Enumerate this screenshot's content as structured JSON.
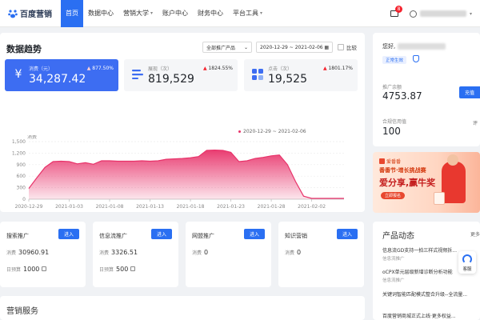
{
  "brand": {
    "name": "百度营销"
  },
  "nav": {
    "items": [
      {
        "label": "首页",
        "active": true,
        "caret": false
      },
      {
        "label": "数据中心",
        "active": false,
        "caret": false
      },
      {
        "label": "营销大学",
        "active": false,
        "caret": true
      },
      {
        "label": "账户中心",
        "active": false,
        "caret": false
      },
      {
        "label": "财务中心",
        "active": false,
        "caret": false
      },
      {
        "label": "平台工具",
        "active": false,
        "caret": true
      }
    ],
    "mail_badge": "8"
  },
  "trend": {
    "title": "数据趋势",
    "product_select": "全部推广产品",
    "date_range": "2020-12-29 ~ 2021-02-06",
    "compare_label": "比较",
    "metrics": [
      {
        "label": "消费（元）",
        "value": "34,287.42",
        "change": "877.50%"
      },
      {
        "label": "展现（次）",
        "value": "819,529",
        "change": "1824.55%"
      },
      {
        "label": "点击（次）",
        "value": "19,525",
        "change": "1801.17%"
      }
    ],
    "legend": "2020-12-29 ~ 2021-02-06"
  },
  "chart_data": {
    "type": "area",
    "ylabel": "消费",
    "ylim": [
      0,
      1500
    ],
    "yticks": [
      "1,500",
      "1,200",
      "900",
      "600",
      "300",
      "0"
    ],
    "xticks": [
      "2020-12-29",
      "2021-01-03",
      "2021-01-08",
      "2021-01-13",
      "2021-01-18",
      "2021-01-23",
      "2021-01-28",
      "2021-02-02"
    ],
    "series": [
      {
        "name": "",
        "x": [
          "2020-12-29",
          "2020-12-30",
          "2020-12-31",
          "2021-01-01",
          "2021-01-02",
          "2021-01-03",
          "2021-01-04",
          "2021-01-05",
          "2021-01-06",
          "2021-01-07",
          "2021-01-08",
          "2021-01-09",
          "2021-01-10",
          "2021-01-11",
          "2021-01-12",
          "2021-01-13",
          "2021-01-14",
          "2021-01-15",
          "2021-01-16",
          "2021-01-17",
          "2021-01-18",
          "2021-01-19",
          "2021-01-20",
          "2021-01-21",
          "2021-01-22",
          "2021-01-23",
          "2021-01-24",
          "2021-01-25",
          "2021-01-26",
          "2021-01-27",
          "2021-01-28",
          "2021-01-29",
          "2021-01-30",
          "2021-01-31",
          "2021-02-01",
          "2021-02-02",
          "2021-02-03",
          "2021-02-04",
          "2021-02-05",
          "2021-02-06"
        ],
        "values": [
          280,
          560,
          830,
          980,
          990,
          980,
          920,
          950,
          910,
          1000,
          1000,
          990,
          990,
          990,
          1000,
          990,
          1000,
          1040,
          1050,
          1060,
          1080,
          1110,
          1270,
          1280,
          1270,
          1220,
          980,
          1000,
          1060,
          1090,
          1130,
          1150,
          900,
          460,
          80,
          20,
          20,
          20,
          20,
          20
        ]
      }
    ],
    "color": "#e8336a"
  },
  "profile": {
    "greeting": "您好,",
    "badge": "正常生效",
    "balance_label": "推广余额",
    "balance_value": "4753.87",
    "charge_label": "充值",
    "score_label": "合规信用值",
    "score_value": "100",
    "edge_label": "评"
  },
  "banner": {
    "logo": "爱番番",
    "line1": "番番节·增长挑战赛",
    "line2": "爱分享,赢牛奖",
    "button": "立即报名"
  },
  "products": [
    {
      "name": "搜索推广",
      "enter": "进入",
      "r1_label": "消费",
      "r1_value": "30960.91",
      "r2_label": "日预算",
      "r2_value": "1000"
    },
    {
      "name": "信息流推广",
      "enter": "进入",
      "r1_label": "消费",
      "r1_value": "3326.51",
      "r2_label": "日预算",
      "r2_value": "500"
    },
    {
      "name": "网盟推广",
      "enter": "进入",
      "r1_label": "消费",
      "r1_value": "0",
      "r2_label": "",
      "r2_value": ""
    },
    {
      "name": "知识营销",
      "enter": "进入",
      "r1_label": "消费",
      "r1_value": "0",
      "r2_label": "",
      "r2_value": ""
    }
  ],
  "news": {
    "title": "产品动态",
    "more": "更多",
    "items": [
      {
        "text": "信息流GD支持一拍三样式视频拆...",
        "sub": "信息流推广"
      },
      {
        "text": "oCPX单元层级新增诊断分析功能",
        "sub": "信息流推广"
      },
      {
        "text": "关键词智能匹配模式整合升级--全流量...",
        "sub": ""
      },
      {
        "text": "百度营销商城正式上线·更多权益...",
        "sub": ""
      }
    ],
    "kefu": "客服"
  },
  "services": {
    "title": "营销服务"
  }
}
